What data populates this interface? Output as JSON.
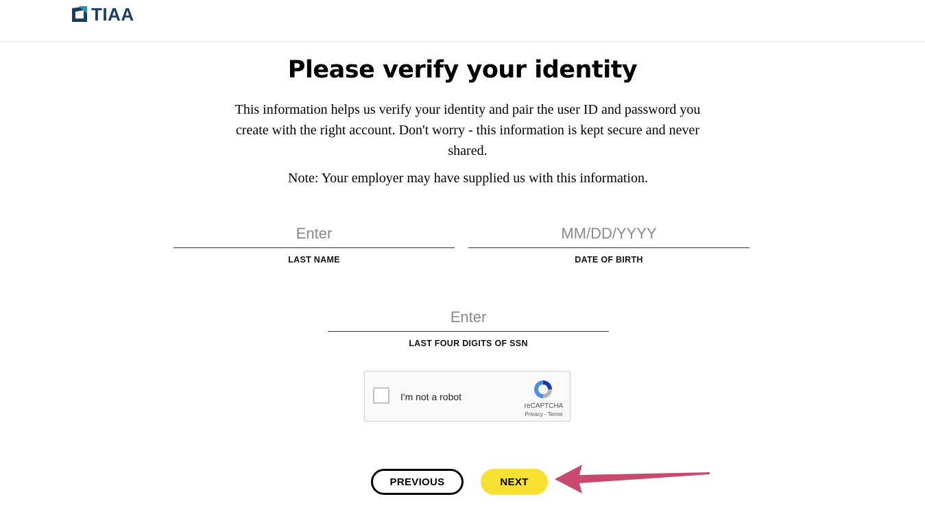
{
  "header": {
    "logo_text": "TIAA"
  },
  "page": {
    "title": "Please verify your identity",
    "intro": "This information helps us verify your identity and pair the user ID and password you create with the right account. Don't worry - this information is kept secure and never shared.",
    "note": "Note: Your employer may have supplied us with this information."
  },
  "form": {
    "last_name": {
      "placeholder": "Enter",
      "value": "",
      "label": "LAST NAME"
    },
    "date_of_birth": {
      "placeholder": "MM/DD/YYYY",
      "value": "",
      "label": "DATE OF BIRTH"
    },
    "ssn_last_four": {
      "placeholder": "Enter",
      "value": "",
      "label": "LAST FOUR DIGITS OF SSN"
    }
  },
  "captcha": {
    "label": "I'm not a robot",
    "brand": "reCAPTCHA",
    "links": "Privacy - Terms",
    "checked": false
  },
  "actions": {
    "previous_label": "PREVIOUS",
    "next_label": "NEXT"
  },
  "colors": {
    "brand_navy": "#1b3f63",
    "brand_teal": "#2f8fb0",
    "next_button": "#f9e131",
    "annotation_arrow": "#c94a6e"
  },
  "icons": {
    "logo": "tiaa-logo-icon",
    "captcha": "recaptcha-icon",
    "annotation": "annotation-arrow-icon"
  }
}
